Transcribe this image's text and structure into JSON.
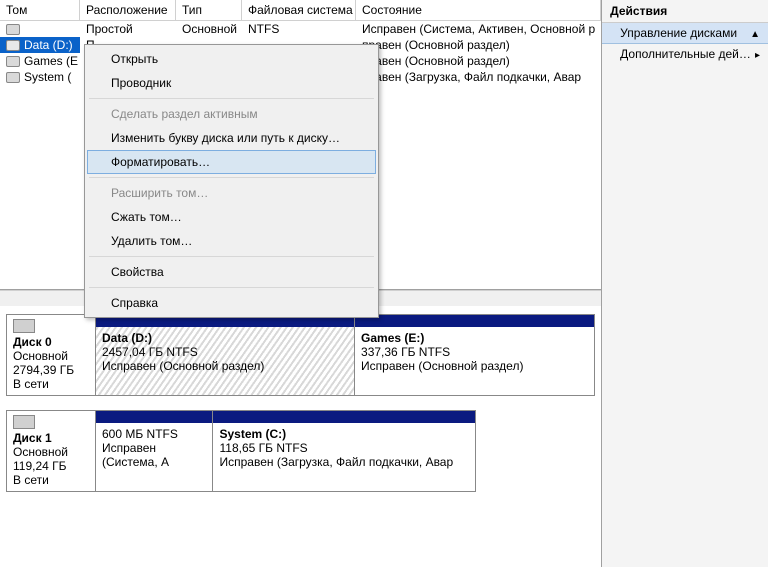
{
  "grid_headers": {
    "vol": "Том",
    "loc": "Расположение",
    "type": "Тип",
    "fs": "Файловая система",
    "status": "Состояние"
  },
  "volumes": [
    {
      "name": "",
      "loc": "Простой",
      "type": "Основной",
      "fs": "NTFS",
      "status": "Исправен (Система, Активен, Основной р"
    },
    {
      "name": "Data (D:)",
      "loc": "П",
      "type": "",
      "fs": "",
      "status": "правен (Основной раздел)"
    },
    {
      "name": "Games (E",
      "loc": "",
      "type": "",
      "fs": "",
      "status": "правен (Основной раздел)"
    },
    {
      "name": "System (",
      "loc": "",
      "type": "",
      "fs": "",
      "status": "правен (Загрузка, Файл подкачки, Авар"
    }
  ],
  "menu": {
    "open": "Открыть",
    "explorer": "Проводник",
    "active": "Сделать раздел активным",
    "change_letter": "Изменить букву диска или путь к диску…",
    "format": "Форматировать…",
    "extend": "Расширить том…",
    "shrink": "Сжать том…",
    "delete": "Удалить том…",
    "properties": "Свойства",
    "help": "Справка"
  },
  "disks": [
    {
      "label": "Диск 0",
      "type": "Основной",
      "size": "2794,39 ГБ",
      "online": "В сети",
      "parts": [
        {
          "title": "Data  (D:)",
          "size": "2457,04 ГБ NTFS",
          "status": "Исправен (Основной раздел)",
          "w": "52%",
          "hatched": true
        },
        {
          "title": "Games  (E:)",
          "size": "337,36 ГБ NTFS",
          "status": "Исправен (Основной раздел)",
          "w": "48%",
          "hatched": false
        }
      ]
    },
    {
      "label": "Диск 1",
      "type": "Основной",
      "size": "119,24 ГБ",
      "online": "В сети",
      "parts": [
        {
          "title": "",
          "size": "600 МБ NTFS",
          "status": "Исправен (Система, А",
          "w": "25%",
          "hatched": false
        },
        {
          "title": "System  (C:)",
          "size": "118,65 ГБ NTFS",
          "status": "Исправен (Загрузка, Файл подкачки, Авар",
          "w": "55%",
          "hatched": false
        }
      ]
    }
  ],
  "actions": {
    "header": "Действия",
    "disk_mgmt": "Управление дисками",
    "more": "Дополнительные дей…"
  }
}
